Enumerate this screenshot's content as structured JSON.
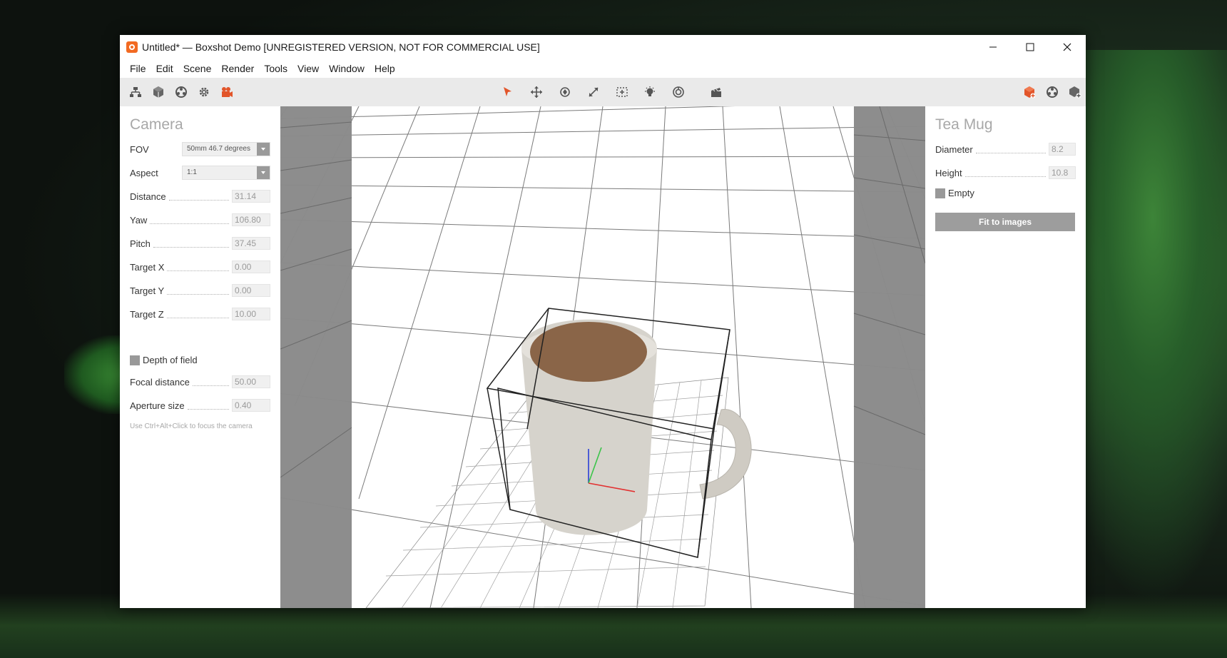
{
  "window": {
    "title": "Untitled* — Boxshot Demo [UNREGISTERED VERSION, NOT FOR COMMERCIAL USE]",
    "controls": {
      "minimize": "—",
      "maximize": "☐",
      "close": "✕"
    }
  },
  "menu": {
    "items": [
      "File",
      "Edit",
      "Scene",
      "Render",
      "Tools",
      "View",
      "Window",
      "Help"
    ]
  },
  "toolbar": {
    "left_icons": [
      "scene-tree-icon",
      "cube-icon",
      "material-sphere-icon",
      "settings-gear-icon",
      "camera-icon"
    ],
    "center_icons": [
      "select-arrow-icon",
      "move-icon",
      "rotate-icon",
      "scale-icon",
      "fit-icon"
    ],
    "light_icons": [
      "light-bulb-icon",
      "environment-icon"
    ],
    "render_icons": [
      "render-clapper-icon"
    ],
    "right_icons": [
      "add-shape-icon",
      "add-material-icon",
      "add-object-icon"
    ],
    "accent_color": "#e2552a"
  },
  "camera_panel": {
    "title": "Camera",
    "fov": {
      "label": "FOV",
      "value": "50mm 46.7 degrees"
    },
    "aspect": {
      "label": "Aspect",
      "value": "1:1"
    },
    "distance": {
      "label": "Distance",
      "value": "31.14"
    },
    "yaw": {
      "label": "Yaw",
      "value": "106.80"
    },
    "pitch": {
      "label": "Pitch",
      "value": "37.45"
    },
    "target_x": {
      "label": "Target X",
      "value": "0.00"
    },
    "target_y": {
      "label": "Target Y",
      "value": "0.00"
    },
    "target_z": {
      "label": "Target Z",
      "value": "10.00"
    },
    "depth_of_field": {
      "label": "Depth of field"
    },
    "focal_distance": {
      "label": "Focal distance",
      "value": "50.00"
    },
    "aperture_size": {
      "label": "Aperture size",
      "value": "0.40"
    },
    "hint": "Use Ctrl+Alt+Click to focus the camera"
  },
  "object_panel": {
    "title": "Tea Mug",
    "diameter": {
      "label": "Diameter",
      "value": "8.2"
    },
    "height": {
      "label": "Height",
      "value": "10.8"
    },
    "empty": {
      "label": "Empty"
    },
    "fit_button": "Fit to images"
  },
  "viewport": {
    "object": "tea-mug",
    "mug_color": "#d6d3cc",
    "coffee_color": "#8a6548",
    "grid_color": "#8a8a8a",
    "side_bar_color": "#8b8b8b"
  }
}
